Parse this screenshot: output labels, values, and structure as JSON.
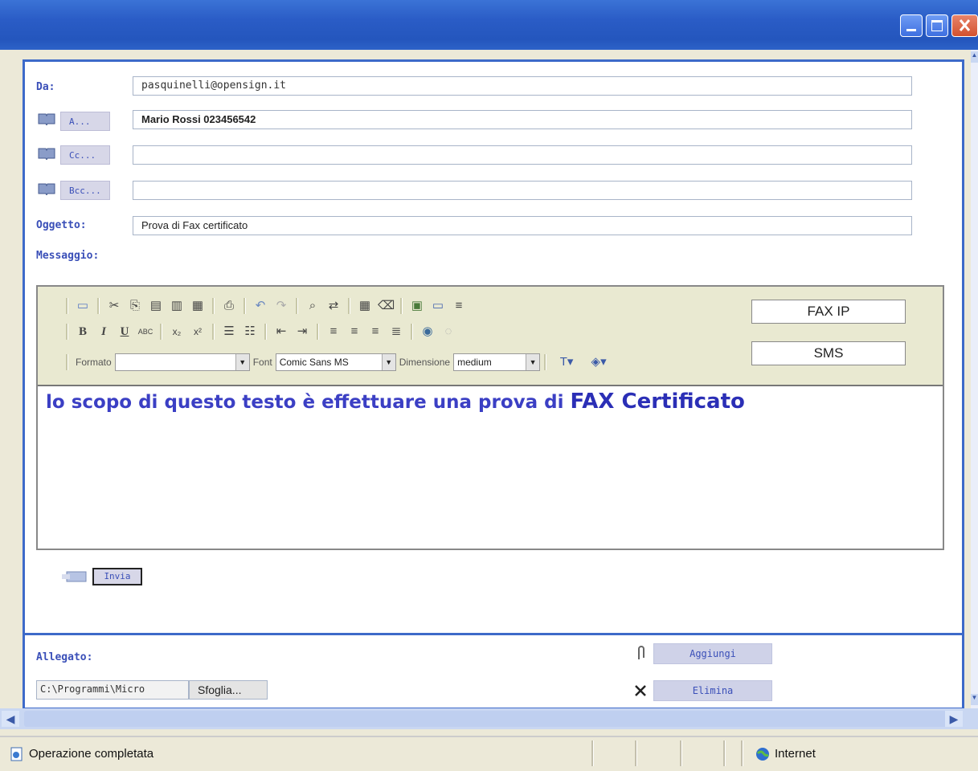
{
  "header": {
    "from_label": "Da:",
    "from_value": "pasquinelli@opensign.it",
    "to_button": "A...",
    "to_value": "Mario Rossi 023456542",
    "cc_button": "Cc...",
    "cc_value": "",
    "bcc_button": "Bcc...",
    "bcc_value": "",
    "subject_label": "Oggetto:",
    "subject_value": "Prova di Fax certificato",
    "message_label": "Messaggio:"
  },
  "editor": {
    "format_label": "Formato",
    "format_value": "",
    "font_label": "Font",
    "font_value": "Comic Sans MS",
    "size_label": "Dimensione",
    "size_value": "medium",
    "fax_ip_button": "FAX IP",
    "sms_button": "SMS",
    "body_text": "lo scopo di questo testo è effettuare una prova di",
    "body_highlight": "FAX Certificato"
  },
  "send_button": "Invia",
  "attachment": {
    "label": "Allegato:",
    "path_value": "C:\\Programmi\\Micro",
    "browse_button": "Sfoglia...",
    "add_button": "Aggiungi",
    "remove_button": "Elimina"
  },
  "status": {
    "message": "Operazione completata",
    "zone": "Internet"
  },
  "colors": {
    "accent": "#3d6ac9",
    "label_blue": "#3a4fb8",
    "titlebar": "#2a5cc6"
  }
}
